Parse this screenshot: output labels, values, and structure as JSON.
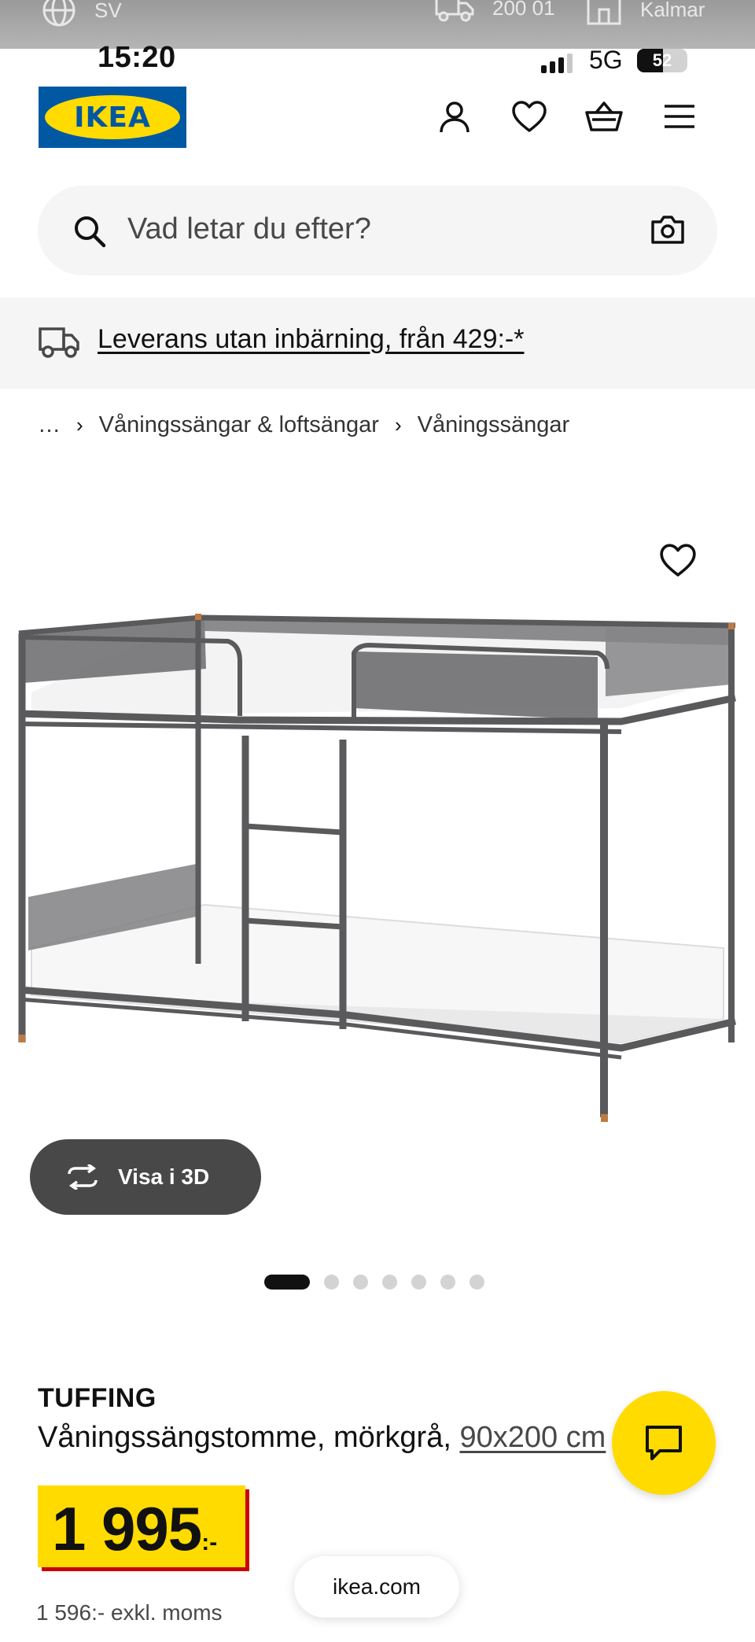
{
  "locale_strip": {
    "language": "SV",
    "postcode": "200 01",
    "store": "Kalmar"
  },
  "status_bar": {
    "time": "15:20",
    "network": "5G",
    "battery": "52",
    "battery_level": 0.52
  },
  "header": {
    "logo_text": "IKEA",
    "icons": [
      "user-icon",
      "heart-icon",
      "basket-icon",
      "menu-icon"
    ]
  },
  "search": {
    "placeholder": "Vad letar du efter?"
  },
  "banner": {
    "text": "Leverans utan inbärning, från 429:-*"
  },
  "breadcrumb": {
    "ellipsis": "…",
    "items": [
      "Våningssängar & loftsängar",
      "Våningssängar"
    ]
  },
  "gallery": {
    "view_3d_label": "Visa i 3D",
    "slide_count": 7,
    "active_slide": 1
  },
  "product": {
    "name": "TUFFING",
    "description": "Våningssängstomme, mörkgrå, ",
    "size_link": "90x200 cm",
    "price": "1 995",
    "price_suffix": ":-",
    "price_ex_vat": "1 596:- exkl. moms"
  },
  "browser": {
    "url": "ikea.com"
  },
  "colors": {
    "ikea_blue": "#0058a3",
    "ikea_yellow": "#ffdb00",
    "price_shadow": "#cc0008",
    "bed_frame": "#5a5a5c"
  }
}
